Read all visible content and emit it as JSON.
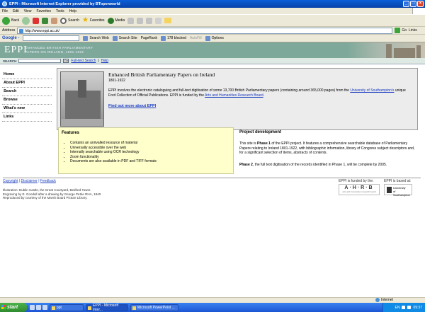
{
  "window": {
    "title": "EPPI - Microsoft Internet Explorer provided by BTopenworld",
    "min_label": "_",
    "max_label": "□",
    "close_label": "×"
  },
  "menu": [
    "File",
    "Edit",
    "View",
    "Favorites",
    "Tools",
    "Help"
  ],
  "toolbar": {
    "back": "Back",
    "search": "Search",
    "favorites": "Favorites",
    "media": "Media"
  },
  "address": {
    "label": "Address",
    "url": "http://www.eppi.ac.uk/",
    "go": "Go",
    "links": "Links"
  },
  "google": {
    "logo": "Google -",
    "search_web": "Search Web",
    "search_site": "Search Site",
    "pagerank": "PageRank",
    "blocked": "178 blocked",
    "autofill": "AutoFill",
    "options": "Options"
  },
  "site": {
    "logo": "EPPI",
    "subtitle_1": "ENHANCED BRITISH PARLIAMENTARY",
    "subtitle_2": "PAPERS ON IRELAND, 1801-1922",
    "search_label": "SEARCH",
    "search_go": "Go",
    "fulltext": "Full-text Search",
    "help": "Help"
  },
  "nav": [
    "Home",
    "About EPPI",
    "Search",
    "Browse",
    "What's new",
    "Links"
  ],
  "hero": {
    "title": "Enhanced British Parliamentary Papers on Ireland",
    "years": "1801-1922",
    "text_1": "EPPI involves the electronic cataloguing and full-text digitisation of some 13,700 British Parliamentary papers (containing around 365,000 pages) from the",
    "link_univ": "University of Southampton's",
    "text_2": "unique Ford Collection of Official Publications. EPPI is funded by the",
    "link_ahrb": "Arts and Humanities Research Board",
    "find_out": "Find out more about EPPI"
  },
  "features": {
    "title": "Features",
    "items": [
      "Contains an unrivalled resource of material",
      "Universally accessible over the web",
      "Internally searchable using OCR technology",
      "Zoom functionality",
      "Documents are also available in PDF and TIFF formats"
    ]
  },
  "development": {
    "title": "Project development",
    "p1_a": "This site is",
    "p1_b": "Phase 1",
    "p1_c": "of the EPPI project. It features a comprehensive searchable database of Parliamentary Papers relating to Ireland 1801-1922, with bibliographic information, library of Congress subject descriptors and, for a significant selection of items, abstracts of contents.",
    "p2_a": "Phase 2",
    "p2_b": ", the full text digitisation of the records identified in Phase 1, will be complete by 2005."
  },
  "footer": {
    "copyright": "Copyright",
    "disclaimer": "Disclaimer",
    "feedback": "Feedback",
    "credit_1": "Illustration: Dublin Castle, the Great Courtyard, Bedford Tower.",
    "credit_2": "Engraving by E. Goodall after a drawing by George Petrie RHA, 1840.",
    "credit_3": "Reproduced by courtesy of the Marsh Board Picture Library.",
    "funded_by": "EPPI is funded by the:",
    "ahrb": "A·H·R·B",
    "ahrb_small": "arts and humanities research board",
    "based_at": "EPPI is based at:",
    "soton_1": "University",
    "soton_2": "of Southampton"
  },
  "status": {
    "zone": "Internet"
  },
  "taskbar": {
    "start": "start",
    "tasks": [
      "ppt",
      "EPPI - Microsoft Inter...",
      "Microsoft PowerPoint ..."
    ],
    "lang": "EN",
    "time": "09:37"
  }
}
